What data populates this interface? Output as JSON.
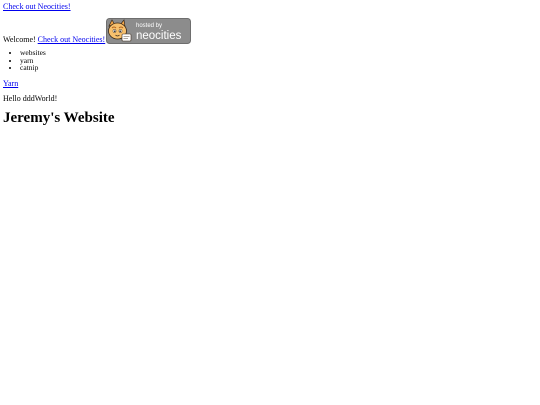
{
  "top_link": {
    "label": "Check out Neocities!"
  },
  "welcome": {
    "text": "Welcome!",
    "link_label": "Check out Neocities!"
  },
  "badge": {
    "line1": "hosted by",
    "line2": "neocities"
  },
  "topics": [
    "websites",
    "yarn",
    "catnip"
  ],
  "yarn_link": {
    "label": "Yarn"
  },
  "hello_text": "Hello dddWorld!",
  "title": "Jeremy's Website",
  "colors": {
    "link": "#0000ee",
    "badge_bg": "#8c8c8c",
    "badge_text": "#ffffff"
  }
}
